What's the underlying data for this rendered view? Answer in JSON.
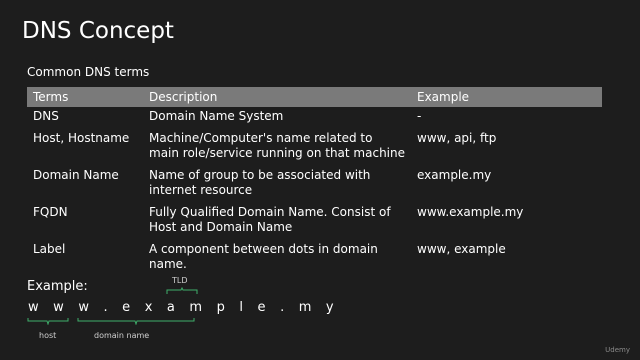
{
  "title": "DNS Concept",
  "subtitle": "Common DNS terms",
  "table": {
    "headers": [
      "Terms",
      "Description",
      "Example"
    ],
    "rows": [
      {
        "term": "DNS",
        "description": "Domain Name System",
        "example": "-"
      },
      {
        "term": "Host, Hostname",
        "description": "Machine/Computer's name related to main role/service running on that machine",
        "example": "www, api, ftp"
      },
      {
        "term": "Domain Name",
        "description": "Name of group to be associated with internet resource",
        "example": "example.my"
      },
      {
        "term": "FQDN",
        "description": "Fully Qualified Domain Name. Consist of Host and Domain Name",
        "example": "www.example.my"
      },
      {
        "term": "Label",
        "description": "A component between dots in domain name.",
        "example": "www, example"
      }
    ]
  },
  "example": {
    "label": "Example:",
    "domain": "w w w . e x a m p l e . m y",
    "tld_label": "TLD",
    "host_label": "host",
    "domain_name_label": "domain name"
  },
  "colors": {
    "background": "#1d1d1d",
    "header_bg": "#7a7a7a",
    "brace": "#3fae6a"
  },
  "logo_text": "Udemy"
}
